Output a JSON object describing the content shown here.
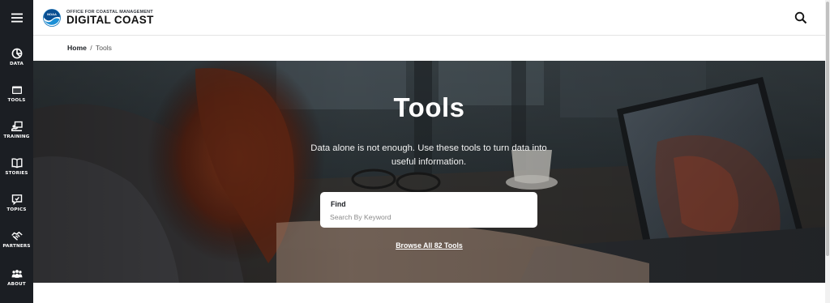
{
  "header": {
    "logo_small": "OFFICE FOR COASTAL MANAGEMENT",
    "logo_big": "DIGITAL COAST",
    "logo_mark_text": "NOAA",
    "icons": {
      "search": "search-icon",
      "menu": "hamburger-menu-icon"
    }
  },
  "sidebar": {
    "items": [
      {
        "label": "DATA",
        "icon": "data-pie-icon"
      },
      {
        "label": "TOOLS",
        "icon": "tools-window-icon"
      },
      {
        "label": "TRAINING",
        "icon": "training-presenter-icon"
      },
      {
        "label": "STORIES",
        "icon": "stories-book-icon"
      },
      {
        "label": "TOPICS",
        "icon": "topics-chat-icon"
      },
      {
        "label": "PARTNERS",
        "icon": "partners-handshake-icon"
      },
      {
        "label": "ABOUT",
        "icon": "about-people-icon"
      }
    ]
  },
  "breadcrumb": {
    "home": "Home",
    "separator": "/",
    "current": "Tools"
  },
  "hero": {
    "title": "Tools",
    "subtitle": "Data alone is not enough. Use these tools to turn data into useful information.",
    "find_label": "Find",
    "find_placeholder": "Search By Keyword",
    "browse_link": "Browse All 82 Tools"
  },
  "colors": {
    "sidebar_bg": "#1b1e23",
    "accent_blue": "#0a6fb7",
    "text_dark": "#1b1e23",
    "white": "#ffffff"
  }
}
